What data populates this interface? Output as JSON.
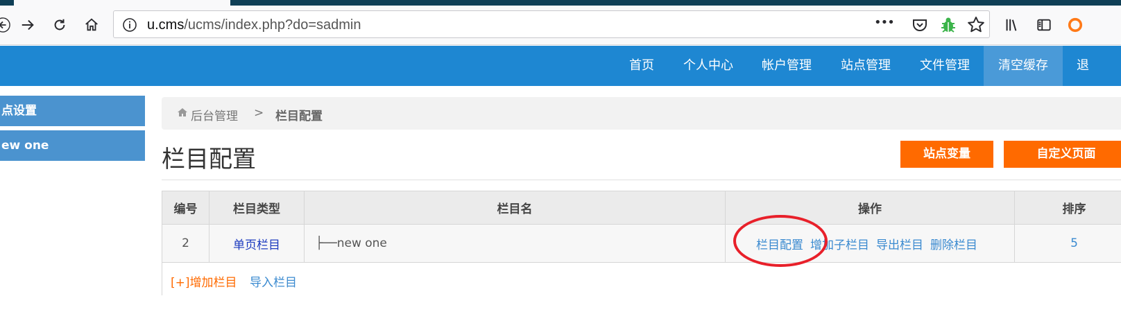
{
  "browser": {
    "url_host": "u.cms",
    "url_path": "/ucms/index.php?do=sadmin",
    "more_glyph": "•••"
  },
  "nav": {
    "items": [
      "首页",
      "个人中心",
      "帐户管理",
      "站点管理",
      "文件管理",
      "清空缓存",
      "退"
    ],
    "active_index": 5
  },
  "sidebar": {
    "items": [
      "点设置",
      "ew one"
    ]
  },
  "breadcrumb": {
    "home": "后台管理",
    "separator": ">",
    "current": "栏目配置"
  },
  "page": {
    "title": "栏目配置",
    "buttons": [
      "站点变量",
      "自定义页面"
    ]
  },
  "table": {
    "headers": [
      "编号",
      "栏目类型",
      "栏目名",
      "操作",
      "排序"
    ],
    "rows": [
      {
        "id": "2",
        "type": "单页栏目",
        "name": "├──new one",
        "actions": [
          "栏目配置",
          "增加子栏目",
          "导出栏目",
          "删除栏目"
        ],
        "order": "5"
      }
    ],
    "footer": {
      "add": "[+]增加栏目",
      "import": "导入栏目"
    }
  },
  "colors": {
    "header_bg": "#1e87d2",
    "accent_orange": "#ff6a00",
    "link_blue": "#3a8ad0",
    "annotation_red": "#e8202a"
  }
}
